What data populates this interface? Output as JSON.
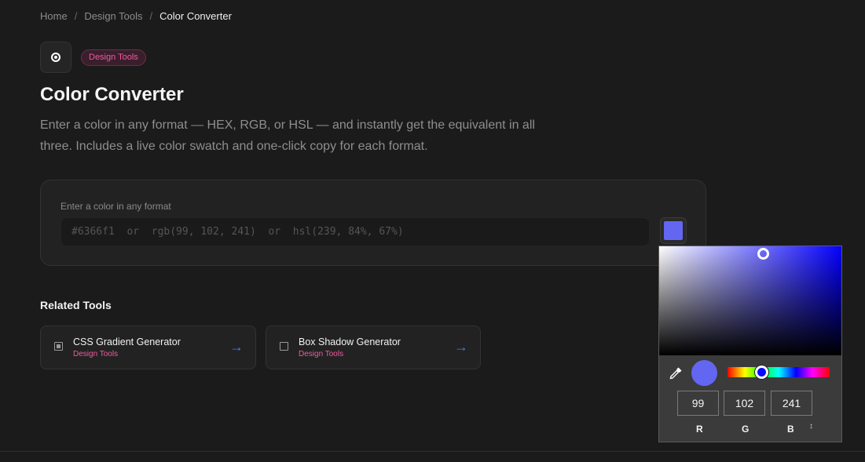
{
  "breadcrumb": {
    "home": "Home",
    "category": "Design Tools",
    "current": "Color Converter",
    "separator": "/"
  },
  "tag": "Design Tools",
  "title": "Color Converter",
  "description": "Enter a color in any format — HEX, RGB, or HSL — and instantly get the equivalent in all three. Includes a live color swatch and one-click copy for each format.",
  "input": {
    "label": "Enter a color in any format",
    "placeholder": "#6366f1  or  rgb(99, 102, 241)  or  hsl(239, 84%, 67%)",
    "value": ""
  },
  "swatch_color": "#6366f1",
  "related": {
    "title": "Related Tools",
    "items": [
      {
        "name": "CSS Gradient Generator",
        "category": "Design Tools",
        "arrow": "→"
      },
      {
        "name": "Box Shadow Generator",
        "category": "Design Tools",
        "arrow": "→"
      }
    ]
  },
  "picker": {
    "r": "99",
    "g": "102",
    "b": "241",
    "labels": {
      "r": "R",
      "g": "G",
      "b": "B"
    },
    "mode_toggle": "↕",
    "hue_color": "#0400ff",
    "preview_color": "#6366f1"
  },
  "colors": {
    "accent_pink": "#f05aa0",
    "arrow_blue": "#4a7be0",
    "background": "#1b1b1b"
  }
}
